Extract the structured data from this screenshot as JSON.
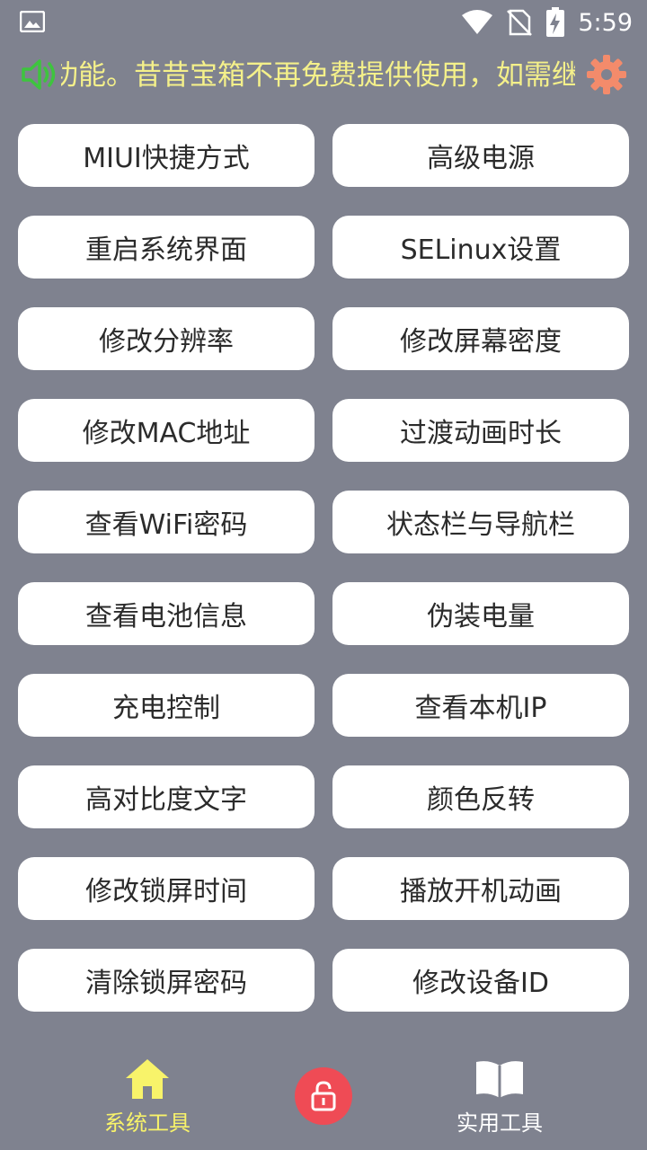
{
  "status_bar": {
    "time": "5:59",
    "icons": [
      "image-icon",
      "wifi-icon",
      "no-sim-icon",
      "battery-charging-icon"
    ]
  },
  "header": {
    "marquee_text": "功能。昔昔宝箱不再免费提供使用，如需继",
    "icons": [
      "speaker-icon",
      "settings-gear-icon"
    ],
    "colors": {
      "marquee_text": "#f4f08a",
      "speaker": "#3ec43e",
      "gear": "#f38b6b"
    }
  },
  "buttons": [
    "MIUI快捷方式",
    "高级电源",
    "重启系统界面",
    "SELinux设置",
    "修改分辨率",
    "修改屏幕密度",
    "修改MAC地址",
    "过渡动画时长",
    "查看WiFi密码",
    "状态栏与导航栏",
    "查看电池信息",
    "伪装电量",
    "充电控制",
    "查看本机IP",
    "高对比度文字",
    "颜色反转",
    "修改锁屏时间",
    "播放开机动画",
    "清除锁屏密码",
    "修改设备ID"
  ],
  "bottom_nav": {
    "home_label": "系统工具",
    "tools_label": "实用工具",
    "icons": [
      "home-icon",
      "lock-icon",
      "book-icon"
    ],
    "colors": {
      "active": "#f8f36a",
      "lock_bg": "#ef4b55",
      "background": "#7f828f"
    }
  }
}
